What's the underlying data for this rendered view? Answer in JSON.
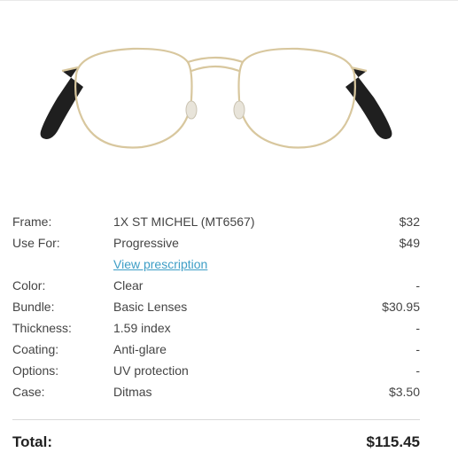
{
  "product": {
    "image_alt": "Gold round metal eyeglasses frame",
    "frame_color": "#d8c79e",
    "temple_color": "#1f1f1f"
  },
  "summary": {
    "rows": [
      {
        "label": "Frame:",
        "value": "1X ST MICHEL (MT6567)",
        "price": "$32"
      },
      {
        "label": "Use For:",
        "value": "Progressive",
        "price": "$49"
      },
      {
        "label": "",
        "link": "View prescription",
        "price": ""
      },
      {
        "label": "Color:",
        "value": "Clear",
        "price": "-"
      },
      {
        "label": "Bundle:",
        "value": "Basic Lenses",
        "price": "$30.95"
      },
      {
        "label": "Thickness:",
        "value": "1.59 index",
        "price": "-"
      },
      {
        "label": "Coating:",
        "value": "Anti-glare",
        "price": "-"
      },
      {
        "label": "Options:",
        "value": "UV protection",
        "price": "-"
      },
      {
        "label": "Case:",
        "value": "Ditmas",
        "price": "$3.50"
      }
    ],
    "total_label": "Total:",
    "total_price": "$115.45"
  },
  "colors": {
    "link": "#3e9ec6",
    "divider": "#d9d9d9"
  }
}
